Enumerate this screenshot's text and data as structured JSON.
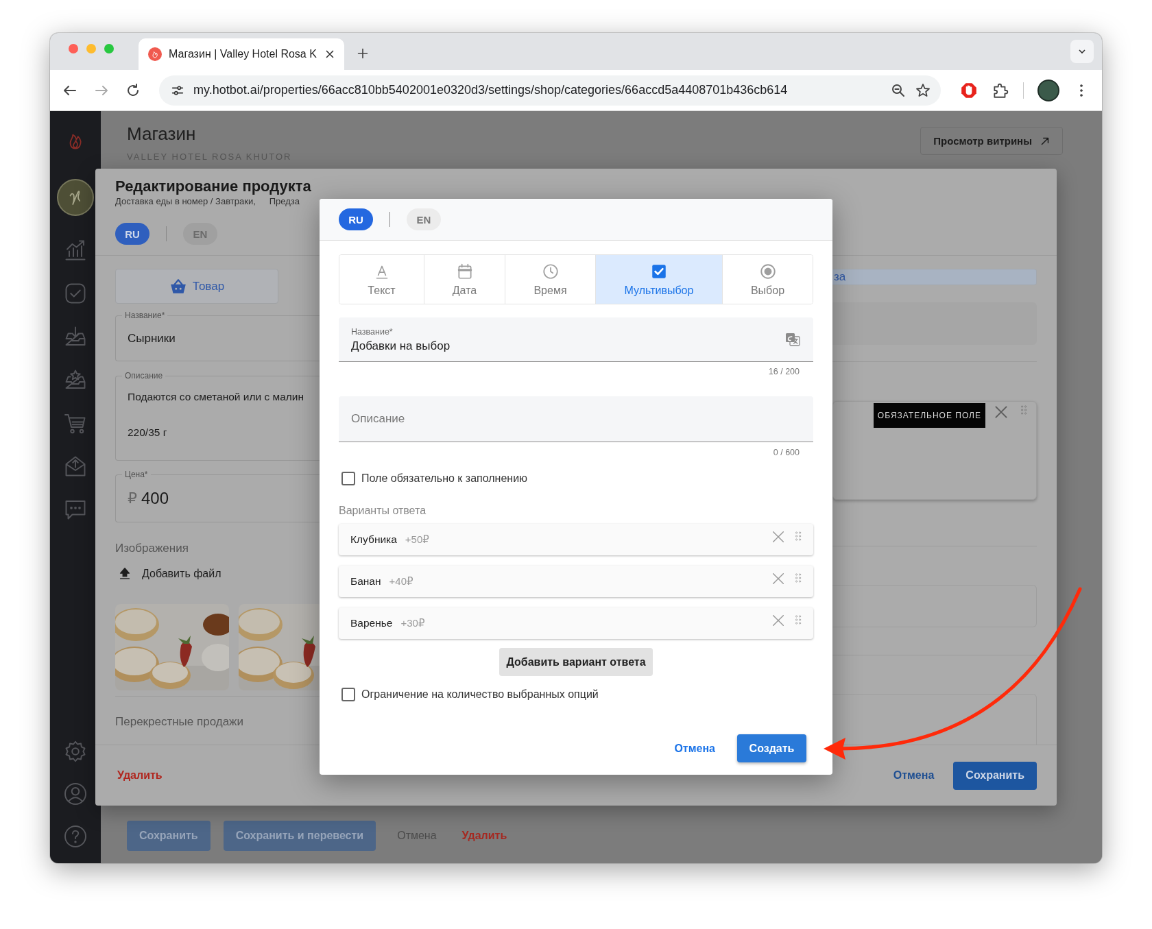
{
  "browser": {
    "tab_title": "Магазин | Valley Hotel Rosa K",
    "url": "my.hotbot.ai/properties/66acc810bb5402001e0320d3/settings/shop/categories/66accd5a4408701b436cb614"
  },
  "page": {
    "title": "Магазин",
    "subtitle": "VALLEY HOTEL ROSA KHUTOR",
    "storefront_button": "Просмотр витрины",
    "actions": [
      {
        "label": "Сохранить",
        "kind": "primary"
      },
      {
        "label": "Сохранить и перевести",
        "kind": "primary"
      },
      {
        "label": "Отмена",
        "kind": "text"
      },
      {
        "label": "Удалить",
        "kind": "danger"
      }
    ]
  },
  "product_dialog": {
    "title": "Редактирование продукта",
    "breadcrumb": "Доставка еды в номер / Завтраки,",
    "breadcrumb_next": "Предза",
    "languages": [
      {
        "label": "RU",
        "selected": true
      },
      {
        "label": "EN",
        "selected": false
      }
    ],
    "tabs": [
      {
        "label": "Товар",
        "selected": false
      },
      {
        "label": "за",
        "selected": true
      }
    ],
    "name": {
      "label": "Название*",
      "value": "Сырники"
    },
    "description": {
      "label": "Описание",
      "lines": [
        "Подаются со сметаной или с малин",
        "220/35 г"
      ]
    },
    "price": {
      "label": "Цена*",
      "currency": "₽",
      "value": "400"
    },
    "images_label": "Изображения",
    "add_file": "Добавить файл",
    "cross_sales": "Перекрестные продажи",
    "required_tag": "ОБЯЗАТЕЛЬНОЕ ПОЛЕ",
    "delete": "Удалить",
    "cancel": "Отмена",
    "save": "Сохранить"
  },
  "field_dialog": {
    "languages": [
      {
        "label": "RU",
        "selected": true
      },
      {
        "label": "EN",
        "selected": false
      }
    ],
    "types": [
      {
        "kind": "text",
        "label": "Текст",
        "selected": false
      },
      {
        "kind": "date",
        "label": "Дата",
        "selected": false
      },
      {
        "kind": "time",
        "label": "Время",
        "selected": false
      },
      {
        "kind": "multi",
        "label": "Мультивыбор",
        "selected": true
      },
      {
        "kind": "single",
        "label": "Выбор",
        "selected": false
      }
    ],
    "name": {
      "label": "Название*",
      "value": "Добавки на выбор",
      "counter": "16 / 200"
    },
    "description": {
      "placeholder": "Описание",
      "counter": "0 / 600"
    },
    "required": {
      "label": "Поле обязательно к заполнению",
      "checked": false
    },
    "options_label": "Варианты ответа",
    "options": [
      {
        "name": "Клубника",
        "price": "+50₽"
      },
      {
        "name": "Банан",
        "price": "+40₽"
      },
      {
        "name": "Варенье",
        "price": "+30₽"
      }
    ],
    "add_option": "Добавить вариант ответа",
    "limit": {
      "label": "Ограничение на количество выбранных опций",
      "checked": false
    },
    "cancel": "Отмена",
    "create": "Создать"
  }
}
